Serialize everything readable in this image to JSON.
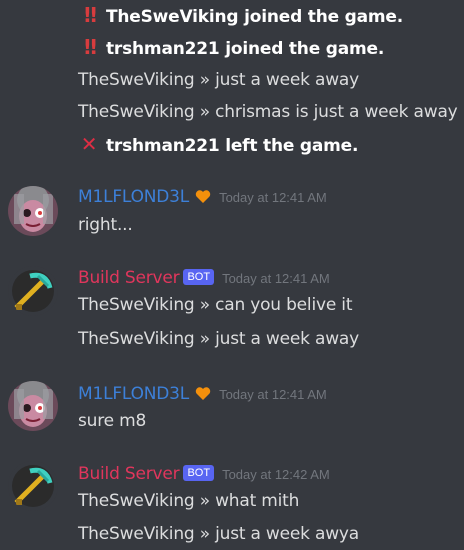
{
  "system": [
    {
      "icon": "double-exclamation-icon",
      "glyph": "‼",
      "text": "TheSweViking joined the game."
    },
    {
      "icon": "double-exclamation-icon",
      "glyph": "‼",
      "text": "trshman221 joined the game."
    },
    {
      "text": "TheSweViking »  just a week away"
    },
    {
      "text": "TheSweViking »  chrismas is just a week away"
    },
    {
      "icon": "cross-mark-icon",
      "glyph": "✕",
      "text": "trshman221 left the game."
    }
  ],
  "messages": [
    {
      "author": "M1LFLOND3L",
      "timestamp": "Today at 12:41 AM",
      "lines": [
        "right..."
      ]
    },
    {
      "author": "Build Server",
      "badge": "BOT",
      "timestamp": "Today at 12:41 AM",
      "lines": [
        "TheSweViking »  can you belive it",
        "TheSweViking »  just a week away"
      ]
    },
    {
      "author": "M1LFLOND3L",
      "timestamp": "Today at 12:41 AM",
      "lines": [
        "sure m8"
      ]
    },
    {
      "author": "Build Server",
      "badge": "BOT",
      "timestamp": "Today at 12:42 AM",
      "lines": [
        "TheSweViking »  what mith",
        "TheSweViking »  just a week awya"
      ]
    }
  ],
  "colors": {
    "background": "#36393f",
    "user_name": "#3d80d8",
    "bot_name": "#e0365c",
    "bot_badge": "#5865f2",
    "timestamp": "#72767d",
    "text": "#dcddde"
  }
}
